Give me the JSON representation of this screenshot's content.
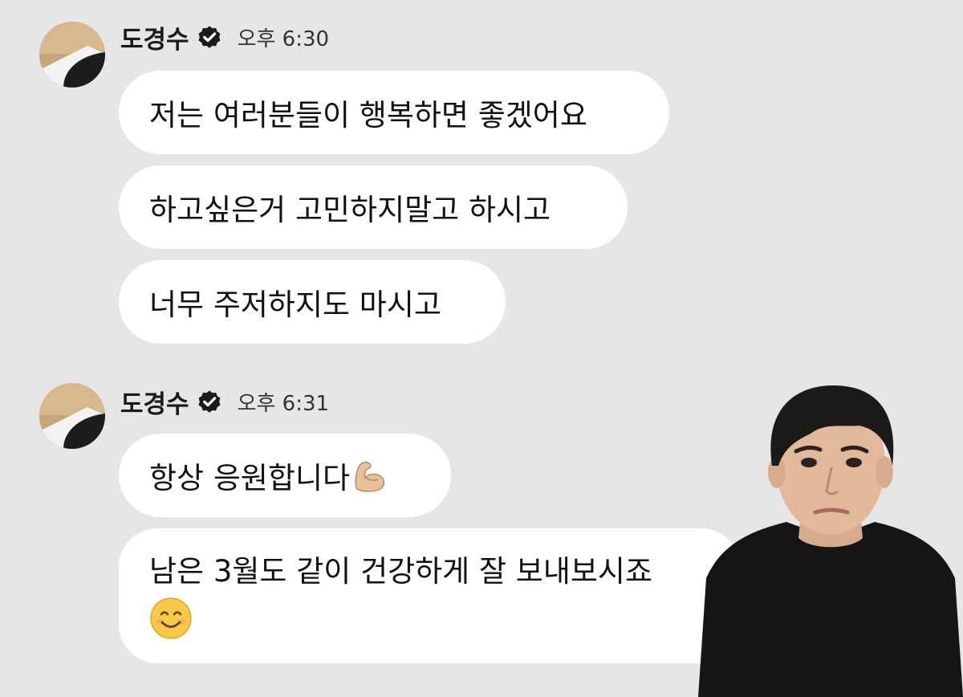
{
  "groups": [
    {
      "sender": "도경수",
      "time": "오후 6:30",
      "messages": [
        "저는 여러분들이 행복하면 좋겠어요",
        "하고싶은거 고민하지말고 하시고",
        "너무 주저하지도 마시고"
      ]
    },
    {
      "sender": "도경수",
      "time": "오후 6:31",
      "messages": [
        "항상 응원합니다",
        "남은 3월도 같이 건강하게 잘 보내보시죠"
      ]
    }
  ],
  "icons": {
    "verified": "verified-badge-icon",
    "flexed_arm": "flexed-biceps-emoji",
    "smile": "smiling-face-emoji"
  },
  "colors": {
    "background": "#e6e6e6",
    "bubble": "#ffffff",
    "verified": "#1a1a1a"
  }
}
